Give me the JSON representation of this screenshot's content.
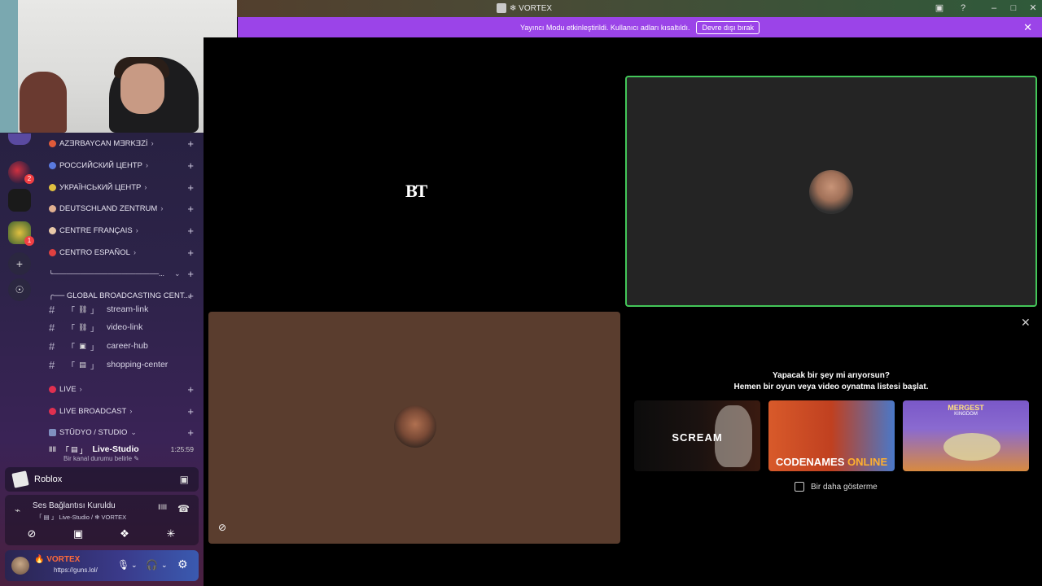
{
  "window": {
    "title": "❄ VORTEX",
    "buttons": {
      "inbox": "▣",
      "help": "?",
      "minimize": "–",
      "maximize": "□",
      "close": "✕"
    }
  },
  "banner": {
    "message": "Yayıncı Modu etkinleştirildi. Kullanıcı adları kısaltıldı.",
    "button": "Devre dışı bırak",
    "close": "✕"
  },
  "guilds": {
    "add": "+",
    "discover": "☉",
    "badge_1": "2",
    "badge_2": "1"
  },
  "categories": [
    {
      "label": "AZƎRBAYCAN MƎRKƎZİ",
      "chev": "›",
      "plus": "+",
      "color": "#e05a3a"
    },
    {
      "label": "РОССИЙСКИЙ ЦЕНТР",
      "chev": "›",
      "plus": "+",
      "color": "#5a7ae0"
    },
    {
      "label": "УКРАЇНСЬКИЙ ЦЕНТР",
      "chev": "›",
      "plus": "+",
      "color": "#e0c040"
    },
    {
      "label": "DEUTSCHLAND ZENTRUM",
      "chev": "›",
      "plus": "+",
      "color": "#e0b090"
    },
    {
      "label": "CENTRE FRANÇAIS",
      "chev": "›",
      "plus": "+",
      "color": "#e8c8a8"
    },
    {
      "label": "CENTRO ESPAÑOL",
      "chev": "›",
      "plus": "+",
      "color": "#e04040"
    },
    {
      "label": "╰───────────────────────...",
      "chev": "⌄",
      "plus": "+",
      "color": ""
    },
    {
      "label": "╭── GLOBAL BROADCASTING CENT...",
      "chev": "",
      "plus": "+",
      "color": ""
    }
  ],
  "text_channels": [
    {
      "hash": "#",
      "bracket_l": "「",
      "icon": "⛓",
      "bracket_r": "」",
      "name": "stream-link"
    },
    {
      "hash": "#",
      "bracket_l": "「",
      "icon": "⛓",
      "bracket_r": "」",
      "name": "video-link"
    },
    {
      "hash": "#",
      "bracket_l": "「",
      "icon": "▣",
      "bracket_r": "」",
      "name": "career-hub"
    },
    {
      "hash": "#",
      "bracket_l": "「",
      "icon": "▤",
      "bracket_r": "」",
      "name": "shopping-center"
    }
  ],
  "live_categories": [
    {
      "label": "LIVE",
      "chev": "›",
      "plus": "+",
      "color": "#e03050"
    },
    {
      "label": "LIVE BROADCAST",
      "chev": "›",
      "plus": "+",
      "color": "#e03050"
    },
    {
      "label": "STÜDYO / STUDIO",
      "chev": "⌄",
      "plus": "+",
      "color": "#8090c0"
    }
  ],
  "voice_channel": {
    "icon": "‖‖",
    "bracket_l": "「",
    "icon2": "▤",
    "bracket_r": "」",
    "name": "Live-Studio",
    "timer": "1:25:59",
    "status": "Bir kanal durumu belirle ✎"
  },
  "activity": {
    "name": "Roblox",
    "action_icon": "▣"
  },
  "voice_panel": {
    "signal": "⌁",
    "title": "Ses Bağlantısı Kuruldu",
    "subtitle": "「 ▤ 」 Live-Studio / ❄ VORTEX",
    "noise": "‖‖‖",
    "disconnect": "☎",
    "btn_camera": "⊘",
    "btn_screen": "▣",
    "btn_activity": "❖",
    "btn_soundboard": "✳"
  },
  "user": {
    "name": "🔥 VORTEX",
    "status": "https://guns.lol/",
    "mic": "🎙",
    "mic_chev": "⌄",
    "headset": "🎧",
    "headset_chev": "⌄",
    "settings": "⚙"
  },
  "tiles": {
    "bt_logo": "BT",
    "cam_off_icon": "⊘"
  },
  "suggestions": {
    "close": "✕",
    "line1": "Yapacak bir şey mi arıyorsun?",
    "line2": "Hemen bir oyun veya video oynatma listesi başlat.",
    "games": [
      {
        "title": "SCREAM"
      },
      {
        "title_a": "CODENAMES",
        "title_b": "ONLINE"
      },
      {
        "title": "MERGEST",
        "subtitle": "KINGDOM"
      }
    ],
    "dont_show": "Bir daha gösterme"
  },
  "colors": {
    "accent": "#9b44e8",
    "speaking": "#43c659",
    "brown_tile": "#5a3d2e"
  }
}
